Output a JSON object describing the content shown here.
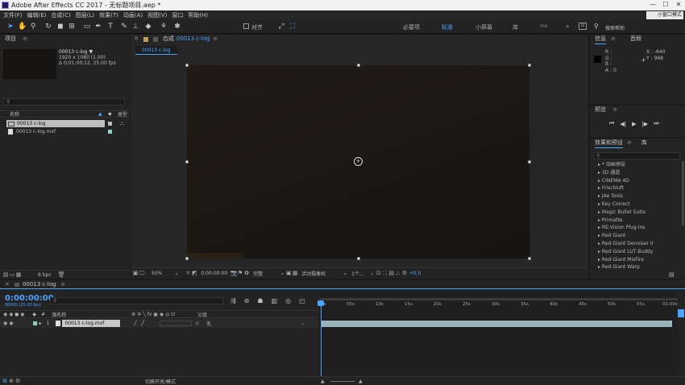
{
  "titlebar": {
    "title": "Adobe After Effects CC 2017 - 无标题项目.aep *",
    "minimize": "—",
    "maximize": "☐",
    "close": "✕"
  },
  "menubar": {
    "items": [
      "文件(F)",
      "编辑(E)",
      "合成(C)",
      "图层(L)",
      "效果(T)",
      "动画(A)",
      "视图(V)",
      "窗口",
      "帮助(H)"
    ],
    "floating_thumb": "小窗口模式"
  },
  "toolbar": {
    "snap_label": "对齐",
    "workspaces": [
      "必要项",
      "标准",
      "小屏幕",
      "库",
      "»"
    ],
    "active_workspace": "标准",
    "search_placeholder": "搜索帮助"
  },
  "project": {
    "header": "项目",
    "menu": "≡",
    "item_name": "00013 c-log ▼",
    "resolution": "1920 x 1080 (1.00)",
    "duration": "Δ 0;01:00:12, 25.00 fps",
    "search_placeholder": "",
    "col_name": "名称",
    "col_type": "类型",
    "items": [
      {
        "name": "00013 c-log",
        "selected": true
      },
      {
        "name": "00013 c-log.mxf",
        "selected": false
      }
    ],
    "bpc": "8 bpc"
  },
  "composition": {
    "header": "合成",
    "tab_name": "00013 c-log",
    "menu": "≡",
    "breadcrumb": "00013 c-log",
    "zoom": "50%",
    "timecode": "0;00:00:00",
    "quality": "完整",
    "camera": "活动摄像机",
    "views": "1个...",
    "exposure": "+0.0"
  },
  "info": {
    "tab_info": "信息",
    "tab_audio": "音频",
    "r": "R :",
    "g": "G :",
    "b": "B :",
    "a": "A : 0",
    "x": "X : -640",
    "y": "Y : 968"
  },
  "preview": {
    "header": "预览",
    "menu": "≡",
    "controls": [
      "⏮",
      "◀|",
      "▶",
      "|▶",
      "⏭"
    ]
  },
  "effects": {
    "header": "效果和预设",
    "library": "库",
    "menu": "≡",
    "search_placeholder": "",
    "items": [
      "▸ * 动画预设",
      "▸ 3D 通道",
      "▸ CINEMA 4D",
      "▸ Frischluft",
      "▸ JAe Tools",
      "▸ Key Correct",
      "▸ Magic Bullet Suite",
      "▸ Primatte",
      "▸ RE:Vision Plug-ins",
      "▸ Red Giant",
      "▸ Red Giant Denoiser II",
      "▸ Red Giant LUT Buddy",
      "▸ Red Giant MisFire",
      "▸ Red Giant Warp"
    ]
  },
  "timeline": {
    "tab": "00013 c-log",
    "menu": "≡",
    "timecode": "0:00:00:00",
    "frame_info": "00000 (25.00 fps)",
    "search_placeholder": "",
    "col_source": "源名称",
    "col_parent": "父级",
    "layer": {
      "index": "1",
      "name": "00013 c-log.mxf",
      "parent": "无"
    },
    "ruler": [
      "0s",
      "05s",
      "10s",
      "15s",
      "20s",
      "25s",
      "30s",
      "35s",
      "40s",
      "45s",
      "50s",
      "55s",
      "01:00s"
    ],
    "footer_label": "切换开关/模式"
  },
  "colors": {
    "accent": "#4aa3ff",
    "layer_bar": "#9bb4bb",
    "label_green": "#8fd0c4",
    "label_swatch": "#7fc6b5"
  }
}
